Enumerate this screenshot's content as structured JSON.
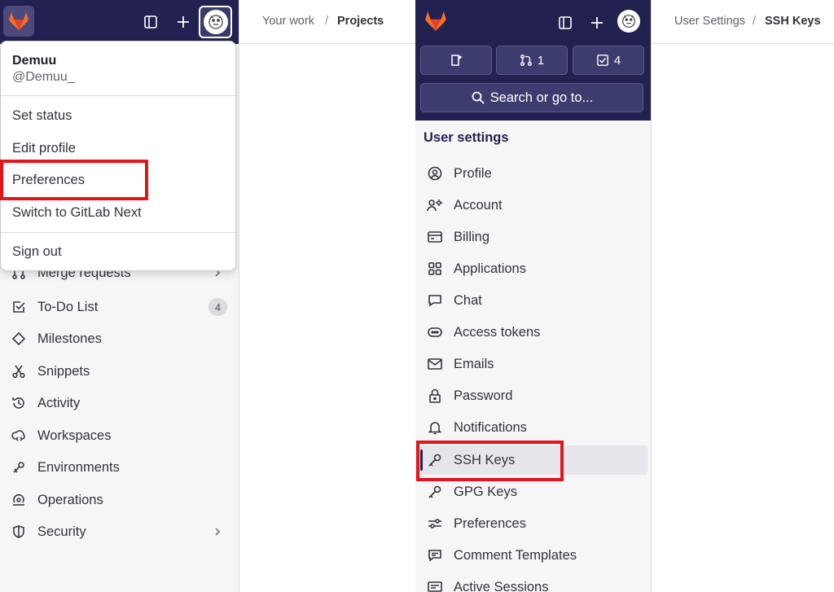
{
  "left": {
    "user": {
      "name": "Demuu",
      "handle": "@Demuu_"
    },
    "menu": {
      "set_status": "Set status",
      "edit_profile": "Edit profile",
      "preferences": "Preferences",
      "switch_next": "Switch to GitLab Next",
      "sign_out": "Sign out"
    },
    "nav": [
      {
        "label": "Merge requests",
        "icon": "merge-request-icon"
      },
      {
        "label": "To-Do List",
        "icon": "todo-icon",
        "badge": "4"
      },
      {
        "label": "Milestones",
        "icon": "milestone-icon"
      },
      {
        "label": "Snippets",
        "icon": "snippet-icon"
      },
      {
        "label": "Activity",
        "icon": "history-icon"
      },
      {
        "label": "Workspaces",
        "icon": "workspace-icon"
      },
      {
        "label": "Environments",
        "icon": "environment-icon"
      },
      {
        "label": "Operations",
        "icon": "operations-icon"
      },
      {
        "label": "Security",
        "icon": "shield-icon"
      }
    ],
    "breadcrumb": {
      "first": "Your work",
      "sep": "/",
      "current": "Projects"
    }
  },
  "right": {
    "counters": {
      "merge_requests": "1",
      "todos": "4"
    },
    "search_label": "Search or go to...",
    "section_title": "User settings",
    "items": [
      {
        "label": "Profile",
        "icon": "profile-icon"
      },
      {
        "label": "Account",
        "icon": "account-icon"
      },
      {
        "label": "Billing",
        "icon": "billing-icon"
      },
      {
        "label": "Applications",
        "icon": "applications-icon"
      },
      {
        "label": "Chat",
        "icon": "chat-icon"
      },
      {
        "label": "Access tokens",
        "icon": "token-icon"
      },
      {
        "label": "Emails",
        "icon": "email-icon"
      },
      {
        "label": "Password",
        "icon": "lock-icon"
      },
      {
        "label": "Notifications",
        "icon": "bell-icon"
      },
      {
        "label": "SSH Keys",
        "icon": "key-icon"
      },
      {
        "label": "GPG Keys",
        "icon": "key-icon"
      },
      {
        "label": "Preferences",
        "icon": "preferences-icon"
      },
      {
        "label": "Comment Templates",
        "icon": "comment-icon"
      },
      {
        "label": "Active Sessions",
        "icon": "sessions-icon"
      }
    ],
    "breadcrumb": {
      "first": "User Settings",
      "sep": "/",
      "current": "SSH Keys"
    }
  },
  "colors": {
    "topbar": "#232150",
    "highlight": "#e3141c",
    "sidebar": "#f6f6f7"
  }
}
